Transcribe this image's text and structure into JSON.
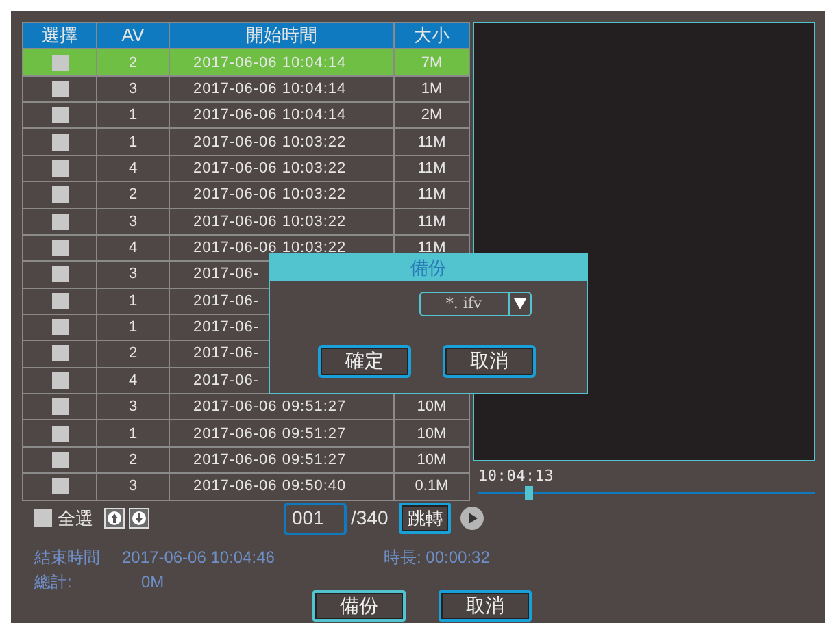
{
  "table": {
    "columns": [
      "選擇",
      "AV",
      "開始時間",
      "大小"
    ],
    "rows": [
      {
        "selected": true,
        "checked": false,
        "av": "2",
        "start_time": "2017-06-06 10:04:14",
        "size": "7M"
      },
      {
        "selected": false,
        "checked": false,
        "av": "3",
        "start_time": "2017-06-06 10:04:14",
        "size": "1M"
      },
      {
        "selected": false,
        "checked": false,
        "av": "1",
        "start_time": "2017-06-06 10:04:14",
        "size": "2M"
      },
      {
        "selected": false,
        "checked": false,
        "av": "1",
        "start_time": "2017-06-06 10:03:22",
        "size": "11M"
      },
      {
        "selected": false,
        "checked": false,
        "av": "4",
        "start_time": "2017-06-06 10:03:22",
        "size": "11M"
      },
      {
        "selected": false,
        "checked": false,
        "av": "2",
        "start_time": "2017-06-06 10:03:22",
        "size": "11M"
      },
      {
        "selected": false,
        "checked": false,
        "av": "3",
        "start_time": "2017-06-06 10:03:22",
        "size": "11M"
      },
      {
        "selected": false,
        "checked": false,
        "av": "4",
        "start_time": "2017-06-06 10:03:22",
        "size": "11M"
      },
      {
        "selected": false,
        "checked": false,
        "av": "3",
        "start_time": "2017-06-"
      },
      {
        "selected": false,
        "checked": false,
        "av": "1",
        "start_time": "2017-06-"
      },
      {
        "selected": false,
        "checked": false,
        "av": "1",
        "start_time": "2017-06-"
      },
      {
        "selected": false,
        "checked": false,
        "av": "2",
        "start_time": "2017-06-"
      },
      {
        "selected": false,
        "checked": false,
        "av": "4",
        "start_time": "2017-06-"
      },
      {
        "selected": false,
        "checked": false,
        "av": "3",
        "start_time": "2017-06-06 09:51:27",
        "size": "10M"
      },
      {
        "selected": false,
        "checked": false,
        "av": "1",
        "start_time": "2017-06-06 09:51:27",
        "size": "10M"
      },
      {
        "selected": false,
        "checked": false,
        "av": "2",
        "start_time": "2017-06-06 09:51:27",
        "size": "10M"
      },
      {
        "selected": false,
        "checked": false,
        "av": "3",
        "start_time": "2017-06-06 09:50:40",
        "size": "0.1M"
      }
    ]
  },
  "player": {
    "time": "10:04:13",
    "level": 0.14
  },
  "select_all": {
    "label": "全選",
    "checked": false
  },
  "pager": {
    "page": "001",
    "total": "/340",
    "jump_button": "跳轉"
  },
  "info": {
    "end_time_label": "結束時間",
    "end_time": "2017-06-06 10:04:46",
    "duration": "時長: 00:00:32",
    "total_label": "總計:",
    "total": "0M"
  },
  "buttons": [
    "備份",
    "取消"
  ],
  "dialog": {
    "title": "備份",
    "format": "*. ifv",
    "buttons": [
      "確定",
      "取消"
    ]
  }
}
